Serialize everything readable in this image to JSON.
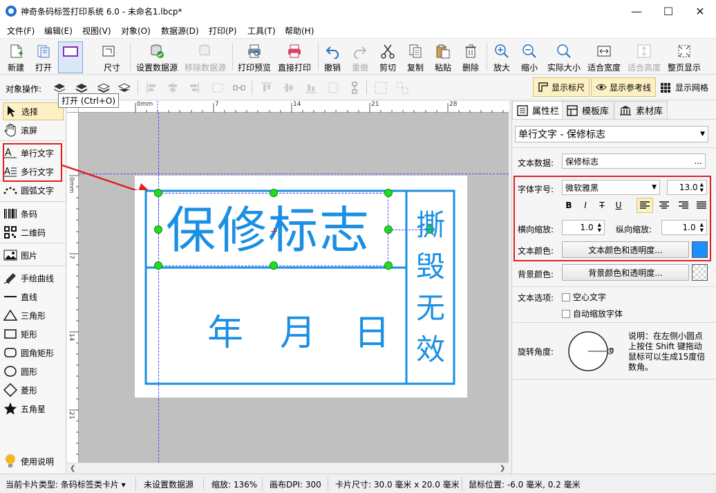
{
  "window": {
    "title": "神奇条码标签打印系统 6.0 - 未命名1.lbcp*",
    "controls": [
      "—",
      "☐",
      "✕"
    ]
  },
  "menu": [
    "文件(F)",
    "编辑(E)",
    "视图(V)",
    "对象(O)",
    "数据源(D)",
    "打印(P)",
    "工具(T)",
    "帮助(H)"
  ],
  "toolbar": {
    "new": "新建",
    "open": "打开",
    "open_tooltip": "打开 (Ctrl+O)",
    "card_size_partial": "尺寸",
    "set_datasource": "设置数据源",
    "remove_datasource": "移除数据源",
    "print_preview": "打印预览",
    "direct_print": "直接打印",
    "undo": "撤销",
    "redo": "重做",
    "cut": "剪切",
    "copy": "复制",
    "paste": "粘贴",
    "delete": "删除",
    "zoom_in": "放大",
    "zoom_out": "缩小",
    "actual_size": "实际大小",
    "fit_width": "适合宽度",
    "fit_height": "适合高度",
    "fit_page": "整页显示"
  },
  "opsbar": {
    "label": "对象操作:",
    "show_ruler": "显示标尺",
    "show_guides": "显示参考线",
    "show_grid": "显示网格"
  },
  "tools": {
    "select": "选择",
    "scroll": "滚屏",
    "single_text": "单行文字",
    "multi_text": "多行文字",
    "arc_text": "圆弧文字",
    "barcode": "条码",
    "qrcode": "二维码",
    "image": "图片",
    "freehand": "手绘曲线",
    "line": "直线",
    "triangle": "三角形",
    "rect": "矩形",
    "rounded_rect": "圆角矩形",
    "circle": "圆形",
    "diamond": "菱形",
    "star": "五角星",
    "help": "使用说明"
  },
  "ruler": {
    "h_labels": [
      "0mm",
      "7",
      "14",
      "21",
      "28"
    ],
    "v_labels": [
      "0mm",
      "7",
      "14",
      "21"
    ]
  },
  "label": {
    "title": "保修标志",
    "date": [
      "年",
      "月",
      "日"
    ],
    "side": [
      "撕",
      "毁",
      "无",
      "效"
    ]
  },
  "panel": {
    "tabs": [
      "属性栏",
      "模板库",
      "素材库"
    ],
    "object_select": "单行文字 - 保修标志",
    "text_data_label": "文本数据:",
    "text_data_value": "保修标志",
    "text_data_more": "...",
    "font_label": "字体字号:",
    "font_name": "微软雅黑",
    "font_size": "13.0",
    "style_bold": "B",
    "style_italic": "I",
    "style_strike": "T",
    "style_underline": "U",
    "hscale_label": "横向缩放:",
    "hscale_value": "1.0",
    "vscale_label": "纵向缩放:",
    "vscale_value": "1.0",
    "text_color_label": "文本颜色:",
    "text_color_button": "文本颜色和透明度...",
    "text_color_swatch": "#1a8fff",
    "bg_color_label": "背景颜色:",
    "bg_color_button": "背景颜色和透明度...",
    "text_options_label": "文本选项:",
    "option_hollow": "空心文字",
    "option_autoscale": "自动缩放字体",
    "rotation_label": "旋转角度:",
    "rotation_value": "0",
    "rotation_note": "说明：在左侧小圆点上按住 Shift 键拖动鼠标可以生成15度倍数角。"
  },
  "status": {
    "card_type": "当前卡片类型:  条码标签类卡片 ▾",
    "datasource": "未设置数据源",
    "zoom": "缩放:  136%",
    "dpi": "画布DPI:  300",
    "card_size": "卡片尺寸:  30.0 毫米 x 20.0 毫米",
    "mouse": "鼠标位置:  -6.0 毫米, 0.2 毫米"
  }
}
